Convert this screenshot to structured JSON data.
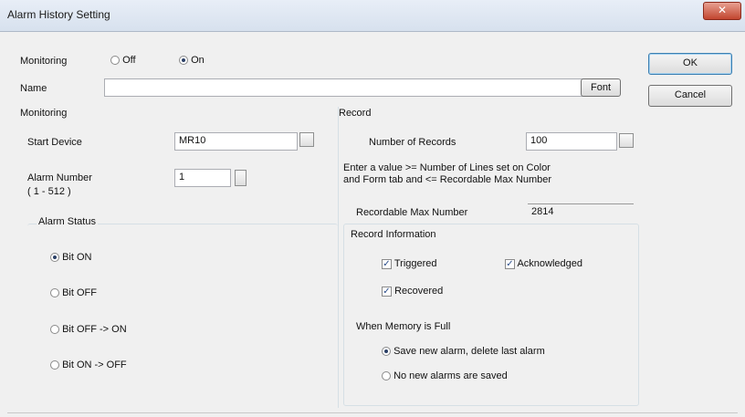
{
  "window": {
    "title": "Alarm History Setting",
    "close_glyph": "✕"
  },
  "monitoring_toggle": {
    "label": "Monitoring",
    "off_label": "Off",
    "on_label": "On",
    "selected": "On"
  },
  "name": {
    "label": "Name",
    "value": "",
    "font_button": "Font"
  },
  "buttons": {
    "ok": "OK",
    "cancel": "Cancel"
  },
  "monitoring_group": {
    "title": "Monitoring",
    "start_device_label": "Start Device",
    "start_device_value": "MR10",
    "alarm_number_label": "Alarm Number",
    "alarm_number_range": "( 1 - 512 )",
    "alarm_number_value": "1",
    "alarm_status": {
      "title": "Alarm Status",
      "options": [
        "Bit ON",
        "Bit OFF",
        "Bit OFF -> ON",
        "Bit ON -> OFF"
      ],
      "selected": "Bit ON"
    }
  },
  "record_group": {
    "title": "Record",
    "num_records_label": "Number of Records",
    "num_records_value": "100",
    "hint_line1": "Enter a value >= Number of Lines set on Color",
    "hint_line2": "and Form tab and <= Recordable Max Number",
    "recordable_max_label": "Recordable Max Number",
    "recordable_max_value": "2814",
    "record_information": {
      "title": "Record Information",
      "triggered": "Triggered",
      "acknowledged": "Acknowledged",
      "recovered": "Recovered"
    },
    "memory_full": {
      "title": "When Memory is Full",
      "option1": "Save new alarm, delete last alarm",
      "option2": "No new alarms are saved",
      "selected": "option1"
    }
  },
  "icons": {
    "check_glyph": "✓",
    "browse": "device-browse-icon"
  }
}
